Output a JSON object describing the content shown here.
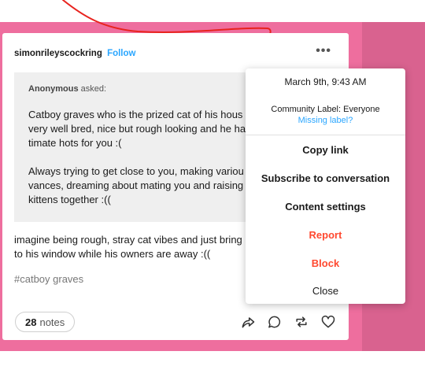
{
  "post": {
    "blog_name": "simonrileyscockring",
    "follow_label": "Follow",
    "ask": {
      "asker": "Anonymous",
      "asked_suffix": " asked:",
      "paragraph_1": [
        "Catboy graves who is the prized cat of his hous",
        "very well bred, nice but rough looking and he ha",
        "timate hots for you :("
      ],
      "paragraph_2": [
        "Always trying to get close to you, making variou",
        "vances, dreaming about mating you and raising",
        "kittens together :(("
      ]
    },
    "answer": [
      "imagine being rough, stray cat vibes and just bring",
      "to his window while his owners are away :(("
    ],
    "tag": "#catboy graves",
    "notes_count": "28",
    "notes_label": "notes"
  },
  "menu": {
    "date": "March 9th, 9:43 AM",
    "community_label": "Community Label: Everyone",
    "missing_label": "Missing label?",
    "items": [
      "Copy link",
      "Subscribe to conversation",
      "Content settings",
      "Report",
      "Block",
      "Close"
    ]
  },
  "icons": {
    "more": "more-horizontal-icon",
    "share": "share-icon",
    "reply": "reply-icon",
    "reblog": "reblog-icon",
    "like": "heart-icon"
  },
  "colors": {
    "background_pink": "#ee6e9e",
    "accent_blue": "#2aa6ff",
    "danger_red": "#ff4930",
    "annotation_red": "#e8231e"
  }
}
